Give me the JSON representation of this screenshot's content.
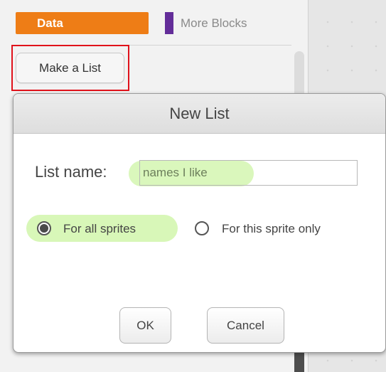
{
  "palette": {
    "categories": [
      {
        "label": "Data",
        "color": "#ee7d16",
        "selected": true
      },
      {
        "label": "More Blocks",
        "color": "#632d99",
        "selected": false
      }
    ],
    "make_list_label": "Make a List",
    "highlight_color": "#e0121b"
  },
  "dialog": {
    "title": "New List",
    "list_name_label": "List name:",
    "list_name_value": "names I like",
    "scope_options": [
      {
        "label": "For all sprites",
        "selected": true
      },
      {
        "label": "For this sprite only",
        "selected": false
      }
    ],
    "ok_label": "OK",
    "cancel_label": "Cancel",
    "annotation_color": "#d8f7b8"
  }
}
